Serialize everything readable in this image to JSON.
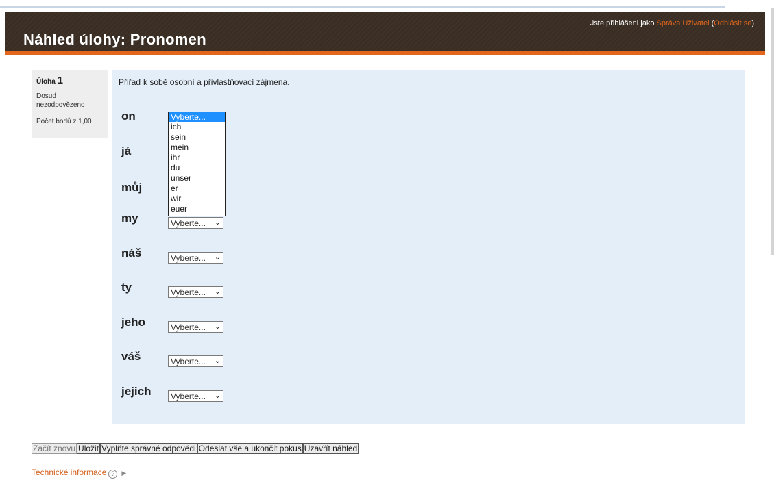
{
  "header": {
    "title": "Náhled úlohy: Pronomen",
    "login_prefix": "Jste přihlášeni jako ",
    "user": "Správa Uživatel",
    "logout_open": " (",
    "logout": "Odhlásit se",
    "logout_close": ")"
  },
  "question_info": {
    "label": "Úloha",
    "number": "1",
    "state": "Dosud nezodpovězeno",
    "grade": "Počet bodů z 1,00"
  },
  "question": {
    "prompt": "Přiřaď k sobě osobní a přivlastňovací zájmena.",
    "placeholder": "Vyberte...",
    "rows": [
      {
        "word": "on"
      },
      {
        "word": "já"
      },
      {
        "word": "můj"
      },
      {
        "word": "my"
      },
      {
        "word": "náš"
      },
      {
        "word": "ty"
      },
      {
        "word": "jeho"
      },
      {
        "word": "váš"
      },
      {
        "word": "jejich"
      }
    ],
    "options": [
      "Vyberte...",
      "ich",
      "sein",
      "mein",
      "ihr",
      "du",
      "unser",
      "er",
      "wir",
      "euer"
    ]
  },
  "buttons": {
    "restart": "Začít znovu",
    "save": "Uložit",
    "fill_correct": "Vyplňte správné odpovědi",
    "submit_all": "Odeslat vše a ukončit  pokus",
    "close_preview": "Uzavřít náhled"
  },
  "tech_info": {
    "label": "Technické informace",
    "help_icon": "question-circle-icon",
    "expand_icon": "triangle-right-icon"
  },
  "colors": {
    "header_bg": "#3a2e24",
    "accent": "#e2661c",
    "content_bg": "#e3eef9",
    "highlight": "#1e90ff"
  }
}
